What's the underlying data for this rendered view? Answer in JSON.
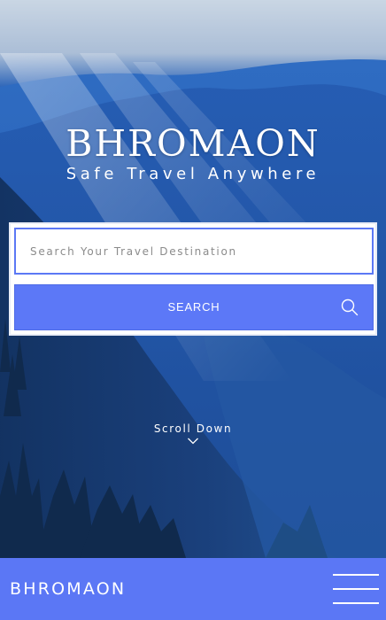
{
  "hero": {
    "title": "BHROMAON",
    "tagline": "Safe Travel Anywhere"
  },
  "search": {
    "placeholder": "Search Your Travel Destination",
    "value": "",
    "button_label": "SEARCH",
    "button_icon": "search-icon"
  },
  "scroll": {
    "label": "Scroll Down",
    "icon": "chevron-down-icon"
  },
  "footer": {
    "logo": "BHROMAON",
    "menu_icon": "hamburger-menu-icon"
  },
  "colors": {
    "accent": "#5b77f5",
    "panel": "#ffffff",
    "text_on_accent": "#ffffff"
  }
}
